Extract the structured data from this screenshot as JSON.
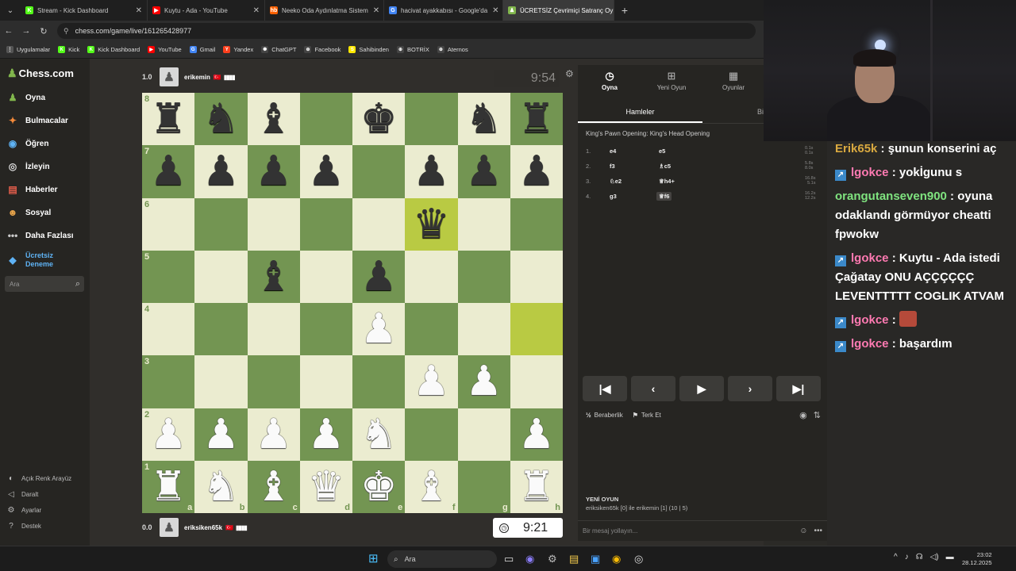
{
  "browser": {
    "tabs": [
      {
        "title": "Stream - Kick Dashboard",
        "icon": "kick-icon",
        "color": "#53fc18",
        "glyph": "K"
      },
      {
        "title": "Kuytu - Ada - YouTube",
        "icon": "youtube-icon",
        "color": "#ff0000",
        "glyph": "▶"
      },
      {
        "title": "Neeko Oda Aydınlatma Sistem",
        "icon": "hepsiburada-icon",
        "color": "#ff6000",
        "glyph": "hb"
      },
      {
        "title": "hacivat ayakkabısı - Google'da",
        "icon": "google-icon",
        "color": "#4285f4",
        "glyph": "G"
      },
      {
        "title": "ÜCRETSİZ Çevrimiçi Satranç Oy",
        "icon": "chess-icon",
        "color": "#81b64c",
        "glyph": "♟"
      }
    ],
    "url": "chess.com/game/live/161265428977",
    "bookmarks": [
      {
        "label": "Uygulamalar",
        "icon": "apps-icon",
        "color": "#555",
        "glyph": "⋮"
      },
      {
        "label": "Kick",
        "icon": "kick-icon",
        "color": "#53fc18",
        "glyph": "K"
      },
      {
        "label": "Kick Dashboard",
        "icon": "kick-icon",
        "color": "#53fc18",
        "glyph": "K"
      },
      {
        "label": "YouTube",
        "icon": "youtube-icon",
        "color": "#ff0000",
        "glyph": "▶"
      },
      {
        "label": "Gmail",
        "icon": "google-icon",
        "color": "#4285f4",
        "glyph": "G"
      },
      {
        "label": "Yandex",
        "icon": "yandex-icon",
        "color": "#fc3f1d",
        "glyph": "Y"
      },
      {
        "label": "ChatGPT",
        "icon": "chatgpt-icon",
        "color": "#444",
        "glyph": "✺"
      },
      {
        "label": "Facebook",
        "icon": "globe-icon",
        "color": "#444",
        "glyph": "⊕"
      },
      {
        "label": "Sahibinden",
        "icon": "sahibinden-icon",
        "color": "#ffe800",
        "glyph": "S"
      },
      {
        "label": "BOTRİX",
        "icon": "globe-icon",
        "color": "#444",
        "glyph": "⊕"
      },
      {
        "label": "Aternos",
        "icon": "globe-icon",
        "color": "#444",
        "glyph": "⊕"
      }
    ]
  },
  "sidebar": {
    "logo": "Chess.com",
    "items": [
      {
        "label": "Oyna",
        "icon": "play-icon",
        "color": "#81b64c",
        "glyph": "♟"
      },
      {
        "label": "Bulmacalar",
        "icon": "puzzle-icon",
        "color": "#f48a3a",
        "glyph": "✦"
      },
      {
        "label": "Öğren",
        "icon": "learn-icon",
        "color": "#5fb3f5",
        "glyph": "◉"
      },
      {
        "label": "İzleyin",
        "icon": "binoculars-icon",
        "color": "#ddd",
        "glyph": "◎"
      },
      {
        "label": "Haberler",
        "icon": "news-icon",
        "color": "#e35d4b",
        "glyph": "▤"
      },
      {
        "label": "Sosyal",
        "icon": "social-icon",
        "color": "#e9a54b",
        "glyph": "☻"
      },
      {
        "label": "Daha Fazlası",
        "icon": "more-icon",
        "color": "#ccc",
        "glyph": "•••"
      }
    ],
    "trial": "Ücretsiz Deneme",
    "search_placeholder": "Ara",
    "bottom": [
      {
        "label": "Açık Renk Arayüz",
        "icon": "theme-icon",
        "glyph": "◐"
      },
      {
        "label": "Daralt",
        "icon": "collapse-icon",
        "glyph": "◁"
      },
      {
        "label": "Ayarlar",
        "icon": "settings-icon",
        "glyph": "⚙"
      },
      {
        "label": "Destek",
        "icon": "help-icon",
        "glyph": "?"
      }
    ]
  },
  "game": {
    "top_player": {
      "score": "1.0",
      "name": "erikemin",
      "flag": "🇹🇷",
      "clock": "9:54"
    },
    "bottom_player": {
      "score": "0.0",
      "name": "eriksiken65k",
      "flag": "🇹🇷",
      "clock": "9:21"
    },
    "board": [
      [
        "r",
        "n",
        "b",
        "",
        "k",
        "",
        "n",
        "r"
      ],
      [
        "p",
        "p",
        "p",
        "p",
        "",
        "p",
        "p",
        "p"
      ],
      [
        "",
        "",
        "",
        "",
        "",
        "q",
        "",
        ""
      ],
      [
        "",
        "",
        "b",
        "",
        "p",
        "",
        "",
        ""
      ],
      [
        "",
        "",
        "",
        "",
        "P",
        "",
        "",
        ""
      ],
      [
        "",
        "",
        "",
        "",
        "",
        "P",
        "P",
        ""
      ],
      [
        "P",
        "P",
        "P",
        "P",
        "N",
        "",
        "",
        "P"
      ],
      [
        "R",
        "N",
        "B",
        "Q",
        "K",
        "B",
        "",
        "R"
      ]
    ],
    "highlight": [
      [
        2,
        5
      ],
      [
        4,
        7
      ]
    ],
    "ranks": [
      "8",
      "7",
      "6",
      "5",
      "4",
      "3",
      "2",
      "1"
    ],
    "files": [
      "a",
      "b",
      "c",
      "d",
      "e",
      "f",
      "g",
      "h"
    ]
  },
  "panel": {
    "tabs": [
      {
        "label": "Oyna",
        "icon": "clock-icon",
        "glyph": "◷"
      },
      {
        "label": "Yeni Oyun",
        "icon": "plus-icon",
        "glyph": "⊞"
      },
      {
        "label": "Oyunlar",
        "icon": "games-icon",
        "glyph": "▦"
      }
    ],
    "subtab_moves": "Hamleler",
    "subtab_other": "Bi",
    "opening": "King's Pawn Opening: King's Head Opening",
    "moves": [
      {
        "n": "1.",
        "w": "e4",
        "b": "e5",
        "tw": "0.1s",
        "tb": "0.1s"
      },
      {
        "n": "2.",
        "w": "f3",
        "b": "♗c5",
        "tw": "5.8s",
        "tb": "8.0s"
      },
      {
        "n": "3.",
        "w": "♘e2",
        "b": "♕h4+",
        "tw": "16.8s",
        "tb": "5.1s"
      },
      {
        "n": "4.",
        "w": "g3",
        "b": "♕f6",
        "tw": "16.2s",
        "tb": "12.2s"
      }
    ],
    "controls": [
      {
        "icon": "first-move-icon",
        "glyph": "|◀"
      },
      {
        "icon": "prev-move-icon",
        "glyph": "‹"
      },
      {
        "icon": "play-icon",
        "glyph": "▶"
      },
      {
        "icon": "next-move-icon",
        "glyph": "›"
      },
      {
        "icon": "last-move-icon",
        "glyph": "▶|"
      }
    ],
    "draw_label": "Beraberlik",
    "resign_label": "Terk Et",
    "new_game_title": "YENİ OYUN",
    "new_game_text": "eriksiken65k [0] ile erikemin [1] (10 | 5)",
    "message_placeholder": "Bir mesaj yollayın..."
  },
  "chat": {
    "messages": [
      {
        "user": "Erik65k",
        "user_class": "usr-yellow",
        "badge": false,
        "text": " : şunun konserini aç",
        "emote": false
      },
      {
        "user": "lgokce",
        "user_class": "usr-pink",
        "badge": true,
        "text": " : yokİgunu s",
        "emote": false
      },
      {
        "user": "orangutanseven900",
        "user_class": "usr-green",
        "badge": false,
        "text": " : oyuna odaklandı görmüyor cheatti fpwokw",
        "emote": false
      },
      {
        "user": "lgokce",
        "user_class": "usr-pink",
        "badge": true,
        "text": " : Kuytu - Ada istedi Çağatay ONU AÇÇÇÇÇÇ LEVENTTTTT COGLIK ATVAM",
        "emote": false
      },
      {
        "user": "lgokce",
        "user_class": "usr-pink",
        "badge": true,
        "text": " : ",
        "emote": true
      },
      {
        "user": "lgokce",
        "user_class": "usr-pink",
        "badge": true,
        "text": " : başardım",
        "emote": false
      }
    ]
  },
  "taskbar": {
    "search_label": "Ara",
    "time": "23:02",
    "date": "28.12.2025"
  }
}
